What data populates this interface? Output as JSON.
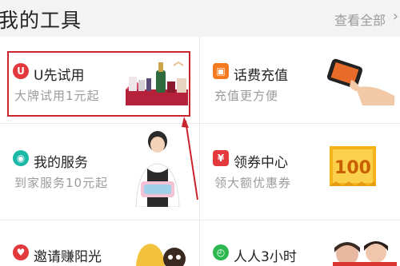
{
  "header": {
    "title": "我的工具",
    "more_label": "查看全部",
    "chevron": "›"
  },
  "colors": {
    "red": "#e4393c",
    "orange": "#f47b1f",
    "teal": "#1ab8a5",
    "green": "#2db84f",
    "highlight": "#c9252d"
  },
  "tools": [
    {
      "name": "U先试用",
      "sub": "大牌试用1元起",
      "icon_text": "U",
      "icon": "u-badge-icon"
    },
    {
      "name": "话费充值",
      "sub": "充值更方便",
      "icon_text": "▣",
      "icon": "phone-bill-icon"
    },
    {
      "name": "我的服务",
      "sub": "到家服务10元起",
      "icon_text": "◉",
      "icon": "service-icon"
    },
    {
      "name": "领券中心",
      "sub": "领大额优惠券",
      "icon_text": "¥",
      "icon": "coupon-icon"
    },
    {
      "name": "邀请赚阳光",
      "sub": "",
      "icon_text": "♥",
      "icon": "invite-icon"
    },
    {
      "name": "人人3小时",
      "sub": "",
      "icon_text": "◴",
      "icon": "clock-icon"
    }
  ],
  "coupon_value": "100"
}
